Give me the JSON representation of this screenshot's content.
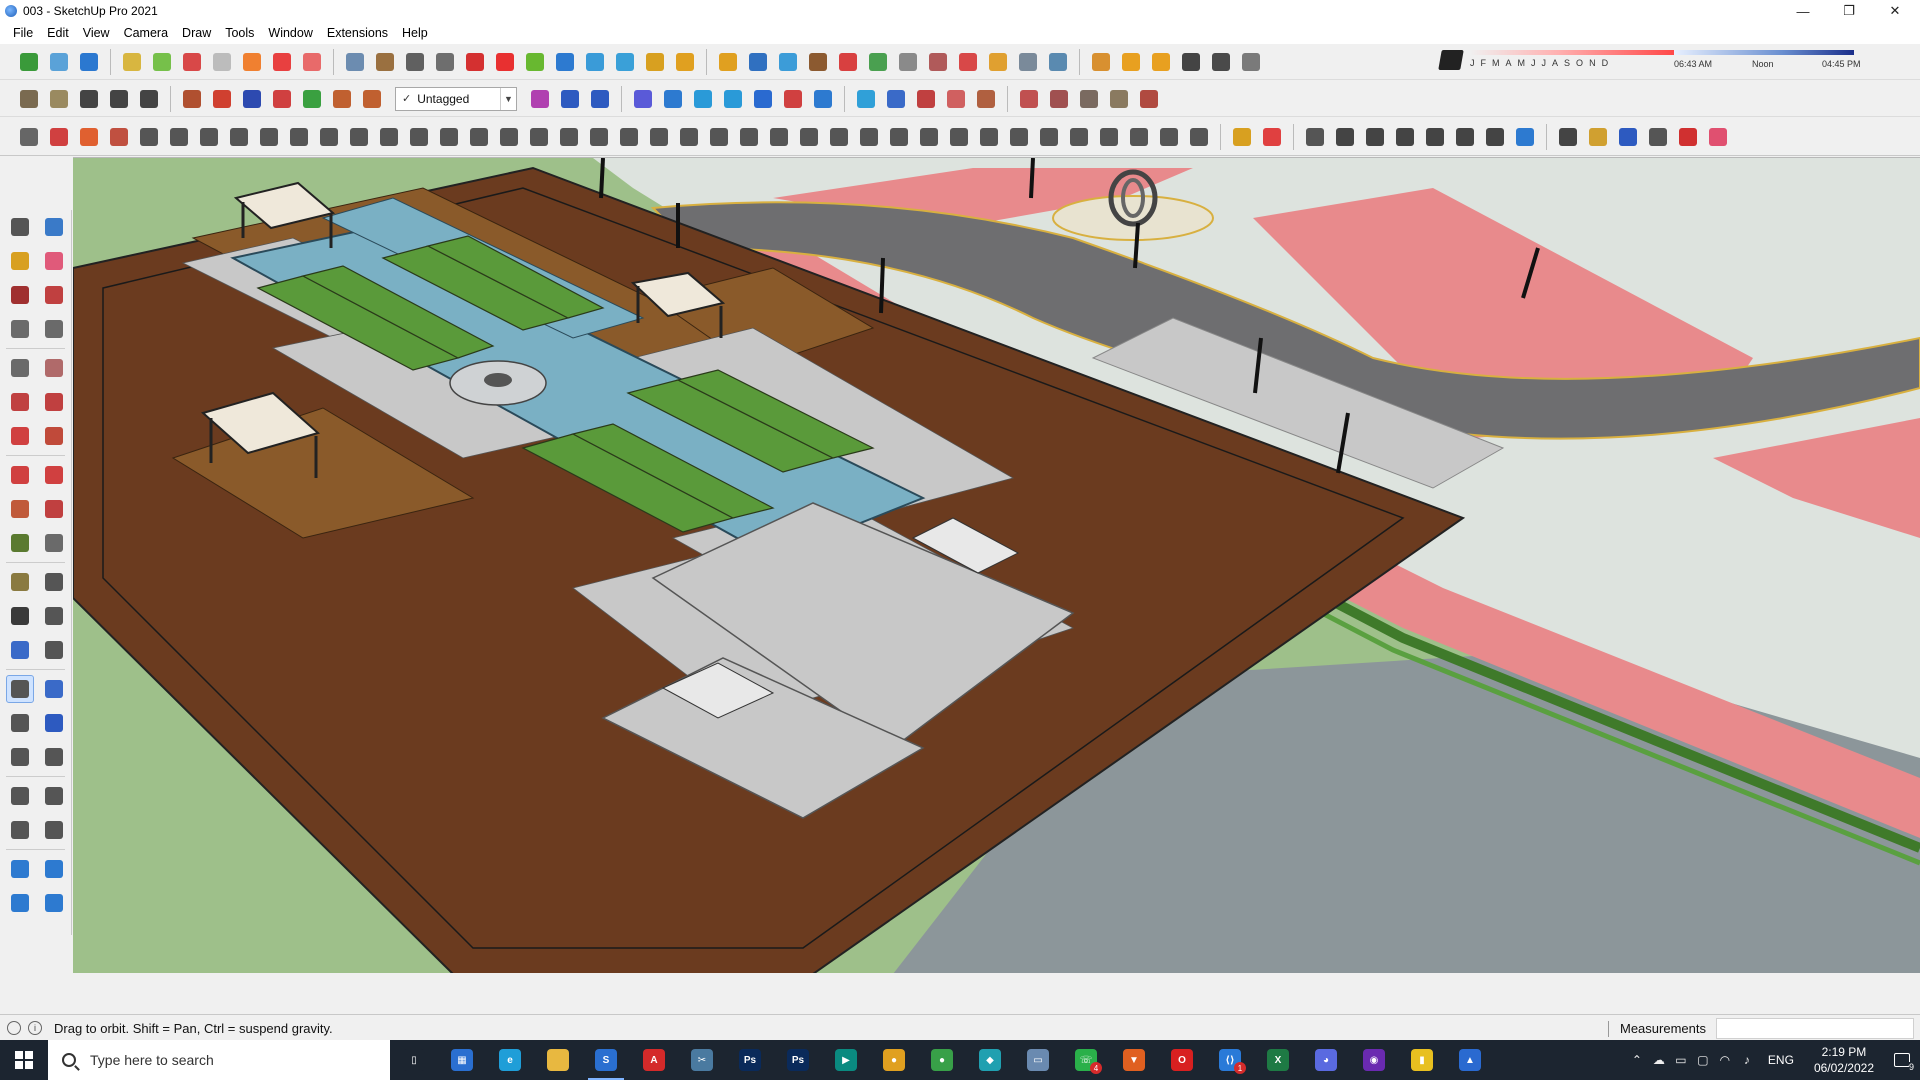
{
  "window": {
    "title": "003 - SketchUp Pro 2021",
    "minimize_icon": "—",
    "restore_icon": "❐",
    "close_icon": "✕"
  },
  "menu": {
    "items": [
      "File",
      "Edit",
      "View",
      "Camera",
      "Draw",
      "Tools",
      "Window",
      "Extensions",
      "Help"
    ]
  },
  "tag_dropdown": {
    "check": "✓",
    "value": "Untagged",
    "arrow": "▼"
  },
  "shadow": {
    "months": [
      "J",
      "F",
      "M",
      "A",
      "M",
      "J",
      "J",
      "A",
      "S",
      "O",
      "N",
      "D"
    ],
    "time_start": "06:43 AM",
    "time_mid": "Noon",
    "time_end": "04:45 PM"
  },
  "toolbar_colors": {
    "row1": [
      "#3a9a3a",
      "#5aa2d8",
      "#2b78d0",
      "#d8b640",
      "#76c04a",
      "#d84848",
      "#bcbcbc",
      "#f08030",
      "#e84040",
      "#e86a6a",
      "#6c8cb0",
      "#9a7040",
      "#606060",
      "#6e6e6e",
      "#d43030",
      "#e83030",
      "#68b830",
      "#2d7ad0",
      "#3a9bd8",
      "#3aa0d8",
      "#d8a020",
      "#e0a020",
      "#e0a020",
      "#3070c0",
      "#3c9cd8",
      "#8c5a30",
      "#d84040",
      "#4aa050",
      "#8a8a8a",
      "#b05a5a",
      "#d84848",
      "#e0a030",
      "#7a8a9a",
      "#5a8ab0",
      "#d89030",
      "#e8a020",
      "#e8a020",
      "#444444",
      "#4a4a4a",
      "#7a7a7a"
    ],
    "row2": [
      "#7a6a50",
      "#9a8a60",
      "#444444",
      "#444444",
      "#444444",
      "#b05030",
      "#d04030",
      "#2d4ab0",
      "#d04040",
      "#3aa040",
      "#c06030",
      "#c06030",
      "#b040b0",
      "#2d5ac0",
      "#2d5ac0",
      "#5a5ad8",
      "#2d7ad0",
      "#2a9ad8",
      "#2a9ad8",
      "#2a6ad0",
      "#d04040",
      "#2d7ad0",
      "#30a0d8",
      "#3a6ac8",
      "#c04040",
      "#d06060",
      "#b06040",
      "#c05050",
      "#a05050",
      "#7a6a60",
      "#8a7a60",
      "#b04a40"
    ],
    "row3": [
      "#666666",
      "#d04040",
      "#e06030",
      "#c05040",
      "#555555",
      "#555555",
      "#555555",
      "#555555",
      "#555555",
      "#555555",
      "#555555",
      "#555555",
      "#555555",
      "#555555",
      "#555555",
      "#555555",
      "#555555",
      "#555555",
      "#555555",
      "#555555",
      "#555555",
      "#555555",
      "#555555",
      "#555555",
      "#555555",
      "#555555",
      "#555555",
      "#555555",
      "#555555",
      "#555555",
      "#555555",
      "#555555",
      "#555555",
      "#555555",
      "#555555",
      "#555555",
      "#555555",
      "#555555",
      "#555555",
      "#555555",
      "#d8a020",
      "#e04040",
      "#555555",
      "#444444",
      "#444444",
      "#444444",
      "#444444",
      "#444444",
      "#444444",
      "#2d7ad0",
      "#444444",
      "#d0a030",
      "#2d5ac0",
      "#555555",
      "#d03030",
      "#e05070"
    ]
  },
  "palette_icons": [
    [
      "select-icon",
      "component-icon"
    ],
    [
      "paint-bucket-icon",
      "eraser-icon"
    ],
    [
      "line-icon",
      "freehand-icon"
    ],
    [
      "rectangle-icon",
      "rotated-rectangle-icon"
    ],
    [
      "circle-icon",
      "polygon-icon"
    ],
    [
      "arc-icon",
      "two-point-arc-icon"
    ],
    [
      "three-point-arc-icon",
      "pie-icon"
    ],
    [
      "move-icon",
      "push-pull-icon"
    ],
    [
      "rotate-icon",
      "follow-me-icon"
    ],
    [
      "scale-icon",
      "offset-icon"
    ],
    [
      "tape-measure-icon",
      "dimension-icon"
    ],
    [
      "protractor-icon",
      "text-icon"
    ],
    [
      "axes-icon",
      "3d-text-icon"
    ],
    [
      "orbit-icon",
      "pan-icon"
    ],
    [
      "zoom-icon",
      "zoom-window-icon"
    ],
    [
      "zoom-extents-icon",
      "previous-view-icon"
    ],
    [
      "position-camera-icon",
      "look-around-icon"
    ],
    [
      "walk-icon",
      "section-plane-icon"
    ],
    [
      "sandbox-from-contours-icon",
      "sandbox-from-scratch-icon"
    ],
    [
      "smoove-icon",
      "stamp-icon"
    ]
  ],
  "status": {
    "info_icon": "i",
    "message": "Drag to orbit. Shift = Pan, Ctrl = suspend gravity.",
    "measurements_label": "Measurements",
    "measurements_value": ""
  },
  "taskbar": {
    "search_placeholder": "Type here to search",
    "apps": [
      {
        "name": "task-view",
        "color": "#1c2530",
        "text": "▯"
      },
      {
        "name": "calculator",
        "color": "#2a6fd0",
        "text": "▦"
      },
      {
        "name": "edge",
        "color": "#1f9ed8",
        "text": "e"
      },
      {
        "name": "file-explorer",
        "color": "#e8b840",
        "text": ""
      },
      {
        "name": "sketchup",
        "color": "#2a6fd0",
        "text": "S"
      },
      {
        "name": "autocad",
        "color": "#d42a2a",
        "text": "A"
      },
      {
        "name": "snipping",
        "color": "#4a7aa0",
        "text": "✂"
      },
      {
        "name": "photoshop-1",
        "color": "#0a2a5a",
        "text": "Ps"
      },
      {
        "name": "photoshop-2",
        "color": "#0a2a5a",
        "text": "Ps"
      },
      {
        "name": "app-teal",
        "color": "#0a8a80",
        "text": "▶"
      },
      {
        "name": "chrome",
        "color": "#e0a020",
        "text": "●"
      },
      {
        "name": "chrome-2",
        "color": "#38a048",
        "text": "●"
      },
      {
        "name": "app-cyan",
        "color": "#20a0b0",
        "text": "◆"
      },
      {
        "name": "sticky",
        "color": "#6a8ab0",
        "text": "▭"
      },
      {
        "name": "whatsapp",
        "color": "#2ab04a",
        "text": "☏"
      },
      {
        "name": "brave",
        "color": "#e06020",
        "text": "▼"
      },
      {
        "name": "opera",
        "color": "#d82020",
        "text": "O"
      },
      {
        "name": "vscode",
        "color": "#2a7ad8",
        "text": "⟨⟩"
      },
      {
        "name": "excel",
        "color": "#1e7a44",
        "text": "X"
      },
      {
        "name": "discord",
        "color": "#5a6ae0",
        "text": "◕"
      },
      {
        "name": "app-purple",
        "color": "#6a2ab0",
        "text": "◉"
      },
      {
        "name": "sticky-notes",
        "color": "#e8c020",
        "text": "▮"
      },
      {
        "name": "photos",
        "color": "#2a6ad0",
        "text": "▲"
      }
    ],
    "badges": {
      "whatsapp": "4",
      "vscode": "1"
    },
    "lang": "ENG",
    "time": "2:19 PM",
    "date": "06/02/2022",
    "notifications": "9"
  },
  "colors": {
    "ground_brown": "#6b3b1f",
    "water": "#7ab0c4",
    "grass": "#5a9a3a",
    "paving_pink": "#e88888",
    "road_gray": "#6e6e70",
    "plaza_gray": "#c8c8c8",
    "sky_green": "#9ec08a"
  }
}
